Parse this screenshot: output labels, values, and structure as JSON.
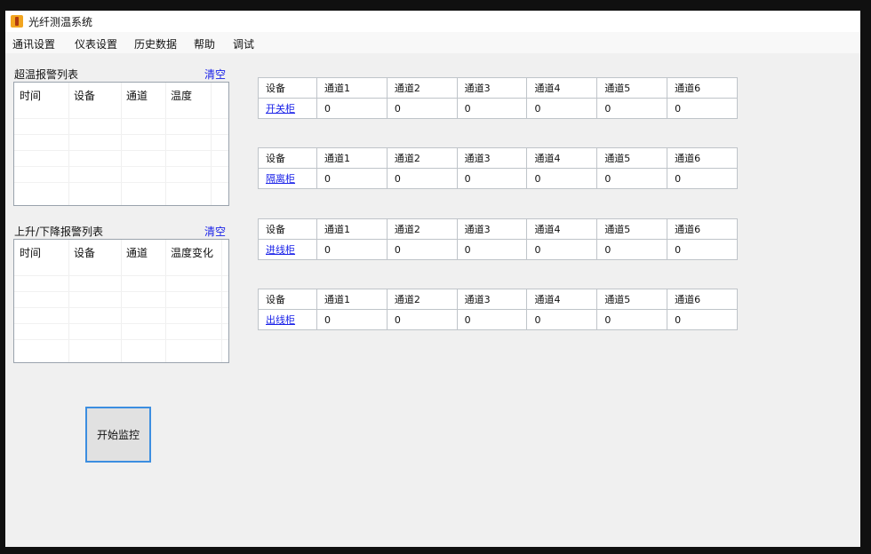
{
  "window": {
    "title": "光纤测温系统"
  },
  "menu": [
    "通讯设置",
    "仪表设置",
    "历史数据",
    "帮助",
    "调试"
  ],
  "over_temp_alarm": {
    "label": "超温报警列表",
    "clear": "清空",
    "columns": [
      "时间",
      "设备",
      "通道",
      "温度"
    ]
  },
  "rise_fall_alarm": {
    "label": "上升/下降报警列表",
    "clear": "清空",
    "columns": [
      "时间",
      "设备",
      "通道",
      "温度变化"
    ]
  },
  "channel_header": [
    "设备",
    "通道1",
    "通道2",
    "通道3",
    "通道4",
    "通道5",
    "通道6"
  ],
  "devices": [
    {
      "name": "开关柜",
      "values": [
        "0",
        "0",
        "0",
        "0",
        "0",
        "0"
      ]
    },
    {
      "name": "隔离柜",
      "values": [
        "0",
        "0",
        "0",
        "0",
        "0",
        "0"
      ]
    },
    {
      "name": "进线柜",
      "values": [
        "0",
        "0",
        "0",
        "0",
        "0",
        "0"
      ]
    },
    {
      "name": "出线柜",
      "values": [
        "0",
        "0",
        "0",
        "0",
        "0",
        "0"
      ]
    }
  ],
  "start_button": "开始监控",
  "colors": {
    "link": "#1a22e8",
    "button_focus": "#3c8ee0",
    "window_bg": "#f0f0f0"
  }
}
